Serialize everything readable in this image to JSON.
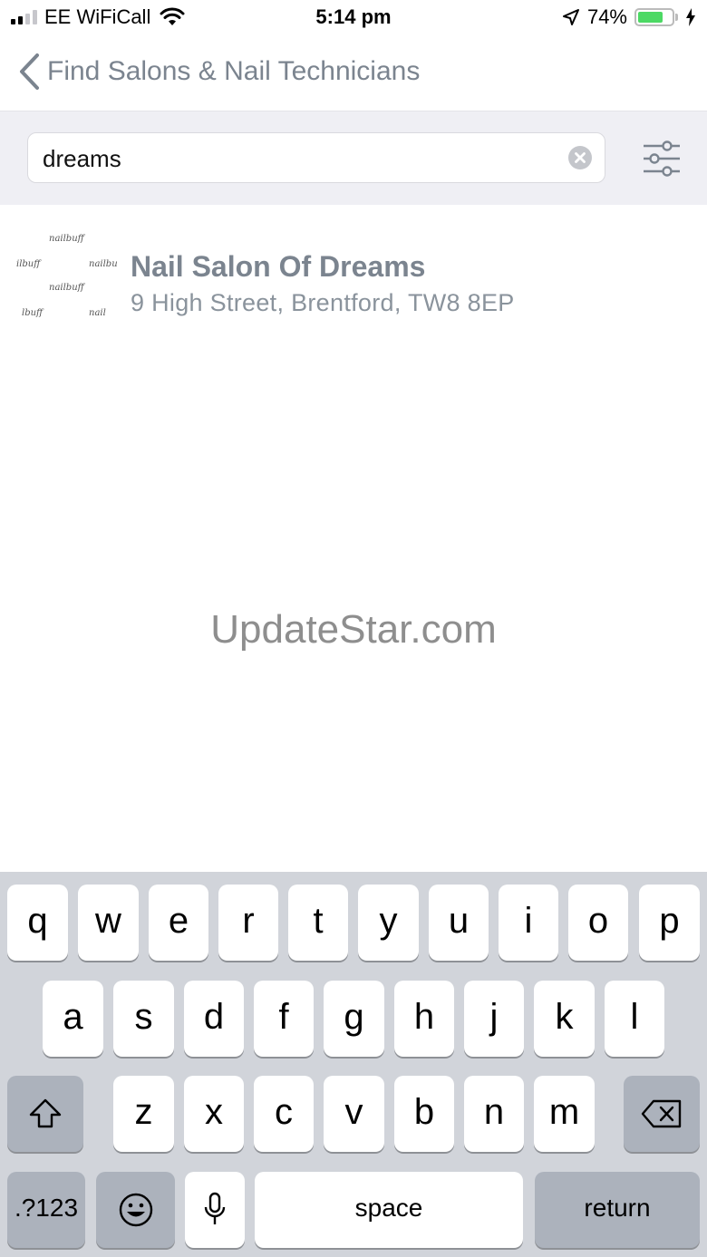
{
  "status_bar": {
    "carrier": "EE WiFiCall",
    "time": "5:14 pm",
    "battery_percent": "74%",
    "battery_level": 0.74,
    "signal_bars_on": 2,
    "signal_bars_total": 4
  },
  "nav": {
    "title": "Find Salons & Nail Technicians"
  },
  "search": {
    "value": "dreams",
    "placeholder": ""
  },
  "results": [
    {
      "name": "Nail Salon Of Dreams",
      "address": "9 High Street, Brentford, TW8 8EP",
      "logo_text": [
        "nailbuff",
        "ilbuff",
        "nailbu",
        "nailbuff",
        "lbuff",
        "nail"
      ]
    }
  ],
  "watermark": "UpdateStar.com",
  "keyboard": {
    "row1": [
      "q",
      "w",
      "e",
      "r",
      "t",
      "y",
      "u",
      "i",
      "o",
      "p"
    ],
    "row2": [
      "a",
      "s",
      "d",
      "f",
      "g",
      "h",
      "j",
      "k",
      "l"
    ],
    "row3": [
      "z",
      "x",
      "c",
      "v",
      "b",
      "n",
      "m"
    ],
    "numbers_label": ".?123",
    "space_label": "space",
    "return_label": "return"
  },
  "colors": {
    "title_gray": "#7b848f",
    "search_bg": "#efeff4",
    "keyboard_bg": "#d1d4da",
    "battery_green": "#4cd964"
  },
  "icons": [
    "back-chevron-icon",
    "clear-icon",
    "filter-sliders-icon",
    "wifi-icon",
    "location-arrow-icon",
    "battery-icon",
    "charging-bolt-icon",
    "shift-icon",
    "backspace-icon",
    "emoji-icon",
    "microphone-icon"
  ]
}
